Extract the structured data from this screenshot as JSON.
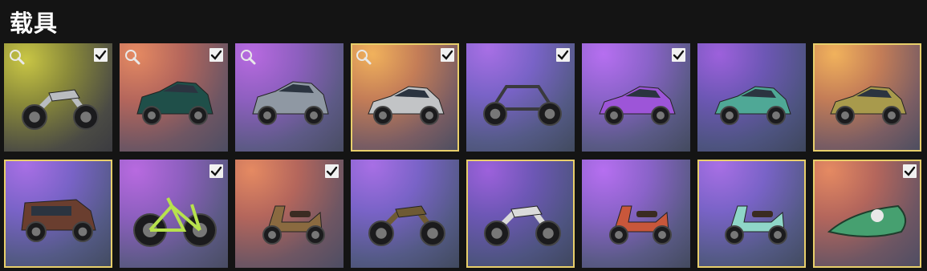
{
  "header": {
    "title": "载具"
  },
  "colors": {
    "selected_border": "#e8cf6b",
    "page_background": "#141414"
  },
  "tiles": [
    {
      "vehicle": "touring-motorcycle",
      "bg": "yellow",
      "key_icon": true,
      "check": true,
      "selected": false,
      "body_color": "#b9bcc0"
    },
    {
      "vehicle": "suv",
      "bg": "orange",
      "key_icon": true,
      "check": true,
      "selected": false,
      "body_color": "#1f4f49"
    },
    {
      "vehicle": "sport-suv",
      "bg": "purple",
      "key_icon": true,
      "check": false,
      "selected": false,
      "body_color": "#8f98a3"
    },
    {
      "vehicle": "sports-car",
      "bg": "gold",
      "key_icon": true,
      "check": true,
      "selected": true,
      "body_color": "#c2c4c6"
    },
    {
      "vehicle": "buggy",
      "bg": "violet",
      "key_icon": false,
      "check": true,
      "selected": false,
      "body_color": "#3a3a3e"
    },
    {
      "vehicle": "sedan-purple",
      "bg": "purple2",
      "key_icon": false,
      "check": true,
      "selected": false,
      "body_color": "#9d55d8"
    },
    {
      "vehicle": "sedan-teal",
      "bg": "deep",
      "key_icon": false,
      "check": false,
      "selected": false,
      "body_color": "#4fa896"
    },
    {
      "vehicle": "sedan-camo",
      "bg": "gold",
      "key_icon": false,
      "check": false,
      "selected": true,
      "body_color": "#a89a4c"
    },
    {
      "vehicle": "jeep",
      "bg": "violet",
      "key_icon": false,
      "check": false,
      "selected": true,
      "body_color": "#6a3e2f"
    },
    {
      "vehicle": "bicycle",
      "bg": "purple",
      "key_icon": false,
      "check": true,
      "selected": false,
      "body_color": "#b7e24d"
    },
    {
      "vehicle": "scooter-brown",
      "bg": "orange",
      "key_icon": false,
      "check": true,
      "selected": false,
      "body_color": "#8a6a40"
    },
    {
      "vehicle": "dirt-bike",
      "bg": "violet",
      "key_icon": false,
      "check": false,
      "selected": false,
      "body_color": "#6e5a34"
    },
    {
      "vehicle": "motorcycle-bw",
      "bg": "deep",
      "key_icon": false,
      "check": false,
      "selected": true,
      "body_color": "#dadada"
    },
    {
      "vehicle": "scooter-colorful",
      "bg": "purple2",
      "key_icon": false,
      "check": false,
      "selected": false,
      "body_color": "#c8573b"
    },
    {
      "vehicle": "scooter-mint",
      "bg": "violet",
      "key_icon": false,
      "check": false,
      "selected": true,
      "body_color": "#8fd6c8"
    },
    {
      "vehicle": "jet-ski",
      "bg": "orange",
      "key_icon": false,
      "check": true,
      "selected": true,
      "body_color": "#46a070"
    }
  ]
}
